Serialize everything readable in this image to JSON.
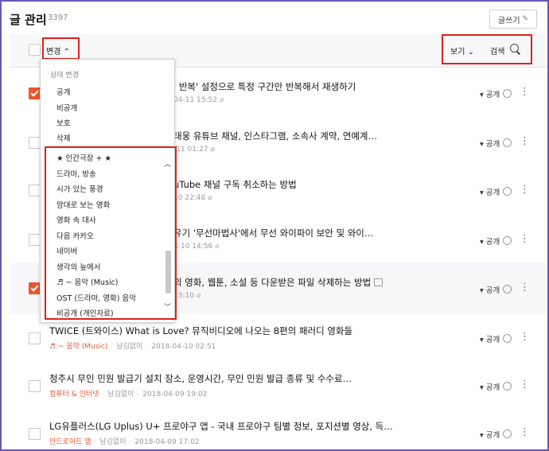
{
  "header": {
    "title": "글 관리",
    "count": "3397",
    "write_label": "글쓰기"
  },
  "toolbar": {
    "change_label": "변경",
    "view_label": "보기",
    "search_label": "검색"
  },
  "dropdown": {
    "status_heading": "상태 변경",
    "status_items": [
      "공개",
      "비공개",
      "보호",
      "삭제"
    ],
    "categories": [
      "★ 인간극장 + ★",
      "드라마, 방송",
      "시가 있는 풍경",
      "맘대로 보는 영화",
      "영화 속 대사",
      "다음 카카오",
      "네이버",
      "생각의 늪에서",
      "♬ ~ 음악 (Music)",
      "OST (드라마, 영화) 음악",
      "비공개 (개인자료)"
    ]
  },
  "posts": [
    {
      "title": "' 반복' 설정으로 특정 구간만 반복해서 재생하기",
      "date": "04-11 15:52",
      "visibility": "공개",
      "checked": true
    },
    {
      "title": "태웅 유튜브 채널, 인스타그램, 소속사 계약, 연예계…",
      "date": "-11 01:27",
      "visibility": "공개",
      "checked": false
    },
    {
      "title": "uTube 채널 구독 취소하는 방법",
      "date": "10 22:48",
      "visibility": "공개",
      "checked": false
    },
    {
      "title": "유기 '무선마법사'에서 무선 와이파이 보안 및 와이…",
      "date": "4-10 14:56",
      "visibility": "공개",
      "checked": false
    },
    {
      "title": "의 영화, 웹툰, 소설 등 다운받은 파일 삭제하는 방법",
      "date": "13:10",
      "visibility": "공개",
      "checked": true
    },
    {
      "title": "TWICE (트와이스) What is Love? 뮤직비디오에 나오는 8편의 패러디 영화들",
      "category": "♬ ~ 음악 (Music)",
      "author": "남김없이",
      "date": "2018-04-10 02:51",
      "visibility": "공개",
      "checked": false
    },
    {
      "title": "청주시 무인 민원 발급기 설치 장소, 운영시간, 무인 민원 발급 종류 및 수수료…",
      "category": "컴퓨터 & 인터넷",
      "author": "남김없이",
      "date": "2018-04-09 19:02",
      "visibility": "공개",
      "checked": false
    },
    {
      "title": "LG유플러스(LG Uplus) U+ 프로야구 앱 - 국내 프로야구 팀별 정보, 포지션별 영상, 득…",
      "category": "안드로이드 앱",
      "author": "남김없이",
      "date": "2018-04-09 17:02",
      "visibility": "공개",
      "checked": false
    }
  ],
  "colors": {
    "accent": "#e8572e",
    "annotation": "#e0211b",
    "frame": "#6a56b8"
  }
}
